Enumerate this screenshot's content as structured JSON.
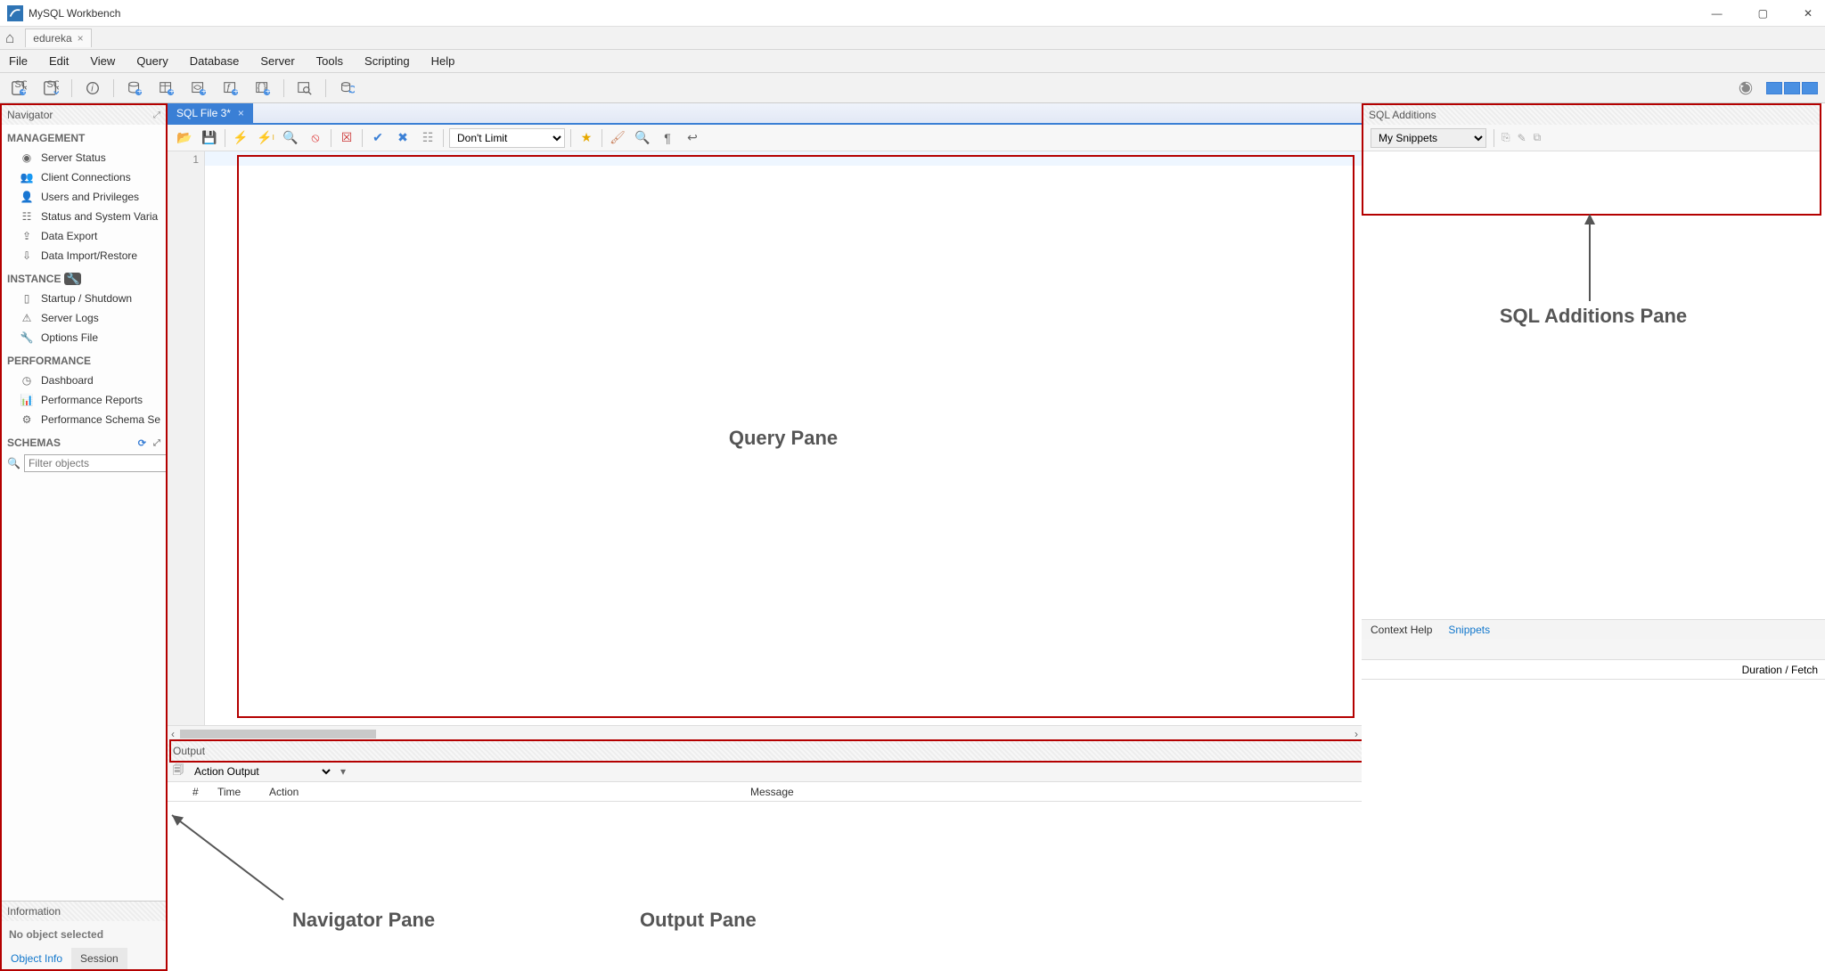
{
  "window": {
    "title": "MySQL Workbench"
  },
  "connection_tab": {
    "label": "edureka"
  },
  "menu": {
    "file": "File",
    "edit": "Edit",
    "view": "View",
    "query": "Query",
    "database": "Database",
    "server": "Server",
    "tools": "Tools",
    "scripting": "Scripting",
    "help": "Help"
  },
  "navigator": {
    "header": "Navigator",
    "management": {
      "title": "MANAGEMENT",
      "items": [
        "Server Status",
        "Client Connections",
        "Users and Privileges",
        "Status and System Varia",
        "Data Export",
        "Data Import/Restore"
      ]
    },
    "instance": {
      "title": "INSTANCE",
      "items": [
        "Startup / Shutdown",
        "Server Logs",
        "Options File"
      ]
    },
    "performance": {
      "title": "PERFORMANCE",
      "items": [
        "Dashboard",
        "Performance Reports",
        "Performance Schema Se"
      ]
    },
    "schemas": {
      "title": "SCHEMAS",
      "filter_placeholder": "Filter objects"
    }
  },
  "info": {
    "header": "Information",
    "msg": "No object selected",
    "tab_object": "Object Info",
    "tab_session": "Session"
  },
  "editor": {
    "tab": "SQL File 3*",
    "line": "1",
    "limit": "Don't Limit"
  },
  "sql_additions": {
    "header": "SQL Additions",
    "snippets": "My Snippets",
    "context_help": "Context Help",
    "snippets_tab": "Snippets"
  },
  "output": {
    "header": "Output",
    "type": "Action Output",
    "cols": {
      "hash": "#",
      "time": "Time",
      "action": "Action",
      "message": "Message",
      "duration": "Duration / Fetch"
    }
  },
  "annot": {
    "query": "Query Pane",
    "sql_add": "SQL Additions Pane",
    "nav": "Navigator Pane",
    "out": "Output Pane"
  }
}
